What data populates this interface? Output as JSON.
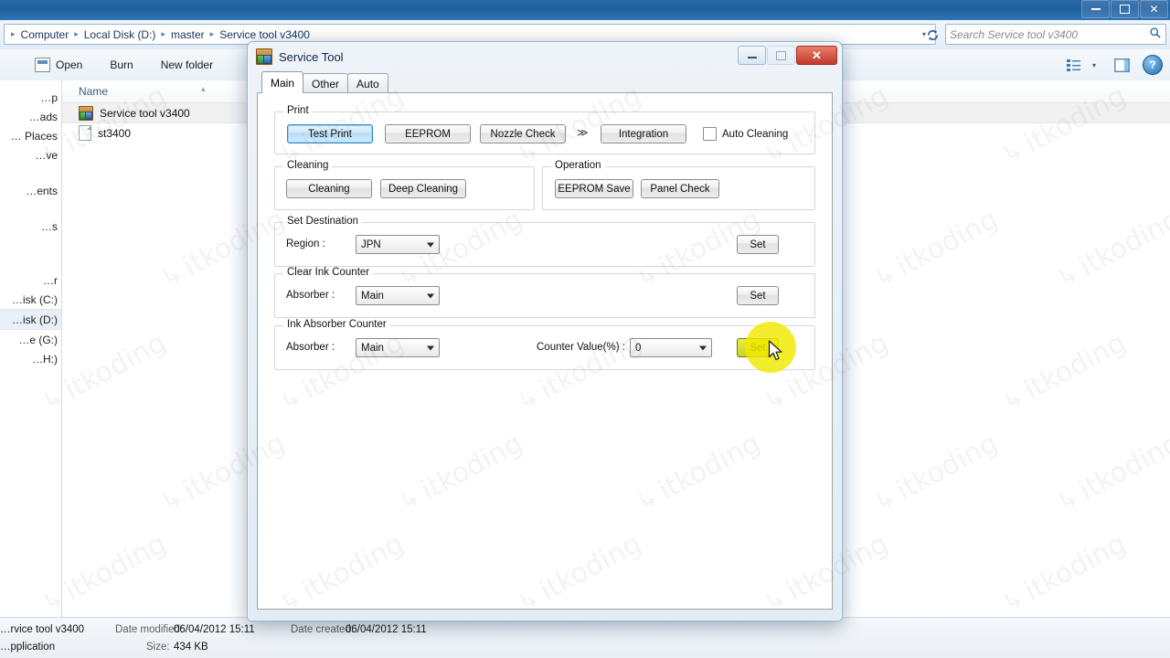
{
  "explorer": {
    "window_controls": {
      "minimize": "—",
      "maximize": "□",
      "close": "✕"
    },
    "breadcrumbs": [
      "Computer",
      "Local Disk (D:)",
      "master",
      "Service tool v3400"
    ],
    "breadcrumb_separator": "▸",
    "address_caret": "▾",
    "refresh_icon": "refresh-icon",
    "search": {
      "placeholder": "Search Service tool v3400",
      "value": "",
      "icon": "search-icon"
    },
    "toolbar": {
      "items": [
        "Open",
        "Burn",
        "New folder"
      ],
      "view_caret": "▾",
      "help_label": "?"
    },
    "sidebar": {
      "items": [
        {
          "label": "…p",
          "selected": false
        },
        {
          "label": "…ads",
          "selected": false
        },
        {
          "label": "… Places",
          "selected": false
        },
        {
          "label": "…ve",
          "selected": false
        },
        {
          "label": "",
          "selected": false
        },
        {
          "label": "…ents",
          "selected": false
        },
        {
          "label": "",
          "selected": false
        },
        {
          "label": "…s",
          "selected": false
        },
        {
          "label": "",
          "selected": false
        },
        {
          "label": "…r",
          "selected": false
        },
        {
          "label": "…isk (C:)",
          "selected": false
        },
        {
          "label": "…isk (D:)",
          "selected": true
        },
        {
          "label": "…e (G:)",
          "selected": false
        },
        {
          "label": "…H:)",
          "selected": false
        }
      ]
    },
    "list": {
      "column_header": "Name",
      "sort_caret": "▴",
      "rows": [
        {
          "name": "Service tool v3400",
          "icon": "application-icon",
          "selected": true
        },
        {
          "name": "st3400",
          "icon": "document-icon",
          "selected": false
        }
      ]
    },
    "status": {
      "file_name": "…rvice tool v3400",
      "file_type": "…pplication",
      "date_modified_label": "Date modified:",
      "date_modified_value": "06/04/2012 15:11",
      "size_label": "Size:",
      "size_value": "434 KB",
      "date_created_label": "Date created:",
      "date_created_value": "06/04/2012 15:11"
    }
  },
  "dialog": {
    "title": "Service Tool",
    "icon": "application-icon",
    "window_controls": {
      "minimize": "—",
      "maximize": "□",
      "close": "✕"
    },
    "tabs": [
      {
        "label": "Main",
        "active": true
      },
      {
        "label": "Other",
        "active": false
      },
      {
        "label": "Auto",
        "active": false
      }
    ],
    "print_group": {
      "legend": "Print",
      "buttons": [
        "Test Print",
        "EEPROM",
        "Nozzle Check"
      ],
      "chevron": "≫",
      "integration_button": "Integration",
      "auto_cleaning_checkbox": {
        "label": "Auto Cleaning",
        "checked": false
      }
    },
    "cleaning_group": {
      "legend": "Cleaning",
      "buttons": [
        "Cleaning",
        "Deep Cleaning"
      ]
    },
    "operation_group": {
      "legend": "Operation",
      "buttons": [
        "EEPROM Save",
        "Panel Check"
      ]
    },
    "set_destination_group": {
      "legend": "Set Destination",
      "field_label": "Region :",
      "value": "JPN",
      "set_button": "Set"
    },
    "clear_ink_counter_group": {
      "legend": "Clear Ink Counter",
      "field_label": "Absorber :",
      "value": "Main",
      "set_button": "Set"
    },
    "ink_absorber_counter_group": {
      "legend": "Ink Absorber Counter",
      "absorber_label": "Absorber :",
      "absorber_value": "Main",
      "counter_label": "Counter Value(%) :",
      "counter_value": "0",
      "set_button": "Set",
      "set_button_highlighted": true
    }
  },
  "watermark": {
    "text": "itkoding",
    "glyph": "↯"
  },
  "colors": {
    "accent_blue": "#2f86c8",
    "titlebar_blue": "#1f5f9e",
    "close_red": "#c0392b",
    "highlight_yellow": "#f2ea00"
  }
}
